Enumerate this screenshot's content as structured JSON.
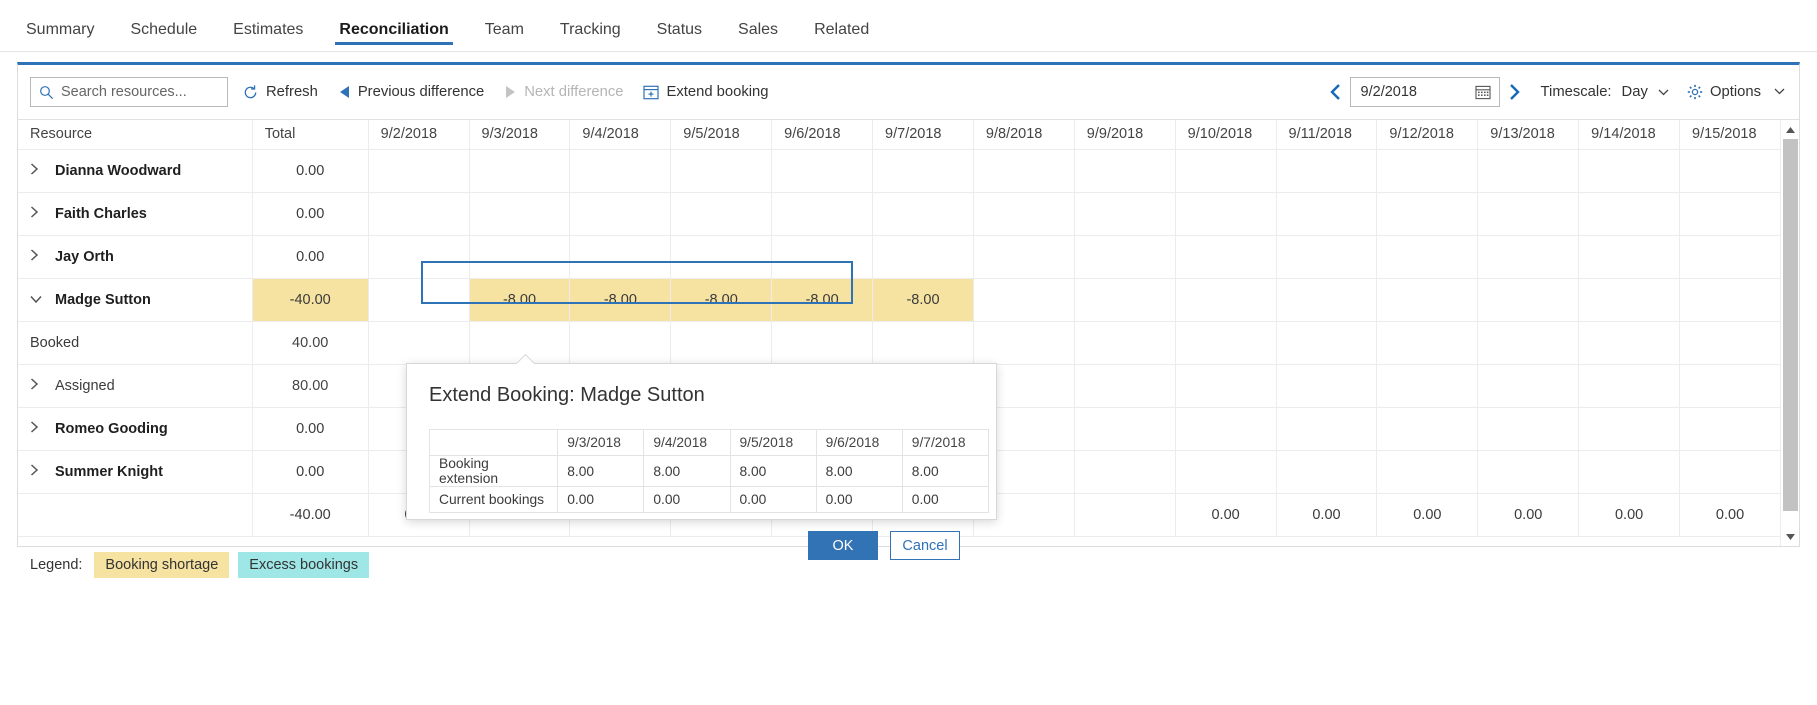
{
  "tabs": [
    {
      "label": "Summary",
      "active": false
    },
    {
      "label": "Schedule",
      "active": false
    },
    {
      "label": "Estimates",
      "active": false
    },
    {
      "label": "Reconciliation",
      "active": true
    },
    {
      "label": "Team",
      "active": false
    },
    {
      "label": "Tracking",
      "active": false
    },
    {
      "label": "Status",
      "active": false
    },
    {
      "label": "Sales",
      "active": false
    },
    {
      "label": "Related",
      "active": false
    }
  ],
  "toolbar": {
    "search_placeholder": "Search resources...",
    "search_value": "",
    "refresh_label": "Refresh",
    "previous_difference_label": "Previous difference",
    "next_difference_label": "Next difference",
    "extend_booking_label": "Extend booking",
    "prev_arrow": "‹",
    "next_arrow": "›",
    "date_value": "9/2/2018",
    "timescale_label": "Timescale:",
    "timescale_value": "Day",
    "options_label": "Options",
    "caret": "⌄"
  },
  "grid": {
    "columns": [
      "Resource",
      "Total",
      "9/2/2018",
      "9/3/2018",
      "9/4/2018",
      "9/5/2018",
      "9/6/2018",
      "9/7/2018",
      "9/8/2018",
      "9/9/2018",
      "9/10/2018",
      "9/11/2018",
      "9/12/2018",
      "9/13/2018",
      "9/14/2018",
      "9/15/2018"
    ],
    "rows": [
      {
        "name": "Dianna Woodward",
        "level": 0,
        "expanded": false,
        "has_chevron": true,
        "bold": true,
        "total": "0.00",
        "total_highlight": "",
        "cells": [
          "",
          "",
          "",
          "",
          "",
          "",
          "",
          "",
          "",
          "",
          "",
          "",
          "",
          ""
        ]
      },
      {
        "name": "Faith Charles",
        "level": 0,
        "expanded": false,
        "has_chevron": true,
        "bold": true,
        "total": "0.00",
        "total_highlight": "",
        "cells": [
          "",
          "",
          "",
          "",
          "",
          "",
          "",
          "",
          "",
          "",
          "",
          "",
          "",
          ""
        ]
      },
      {
        "name": "Jay Orth",
        "level": 0,
        "expanded": false,
        "has_chevron": true,
        "bold": true,
        "total": "0.00",
        "total_highlight": "",
        "cells": [
          "",
          "",
          "",
          "",
          "",
          "",
          "",
          "",
          "",
          "",
          "",
          "",
          "",
          ""
        ]
      },
      {
        "name": "Madge Sutton",
        "level": 0,
        "expanded": true,
        "has_chevron": true,
        "bold": true,
        "total": "-40.00",
        "total_highlight": "shortage",
        "cells": [
          "",
          "-8.00",
          "-8.00",
          "-8.00",
          "-8.00",
          "-8.00",
          "",
          "",
          "",
          "",
          "",
          "",
          "",
          ""
        ],
        "cell_highlight": [
          "",
          "shortage",
          "shortage",
          "shortage",
          "shortage",
          "shortage",
          "",
          "",
          "",
          "",
          "",
          "",
          "",
          ""
        ]
      },
      {
        "name": "Booked",
        "level": 1,
        "expanded": false,
        "has_chevron": false,
        "bold": false,
        "total": "40.00",
        "total_highlight": "",
        "cells": [
          "",
          "",
          "",
          "",
          "",
          "",
          "",
          "",
          "",
          "",
          "",
          "",
          "",
          ""
        ]
      },
      {
        "name": "Assigned",
        "level": 1,
        "expanded": false,
        "has_chevron": true,
        "bold": false,
        "total": "80.00",
        "total_highlight": "",
        "cells": [
          "",
          "",
          "",
          "",
          "",
          "",
          "",
          "",
          "",
          "",
          "",
          "",
          "",
          ""
        ]
      },
      {
        "name": "Romeo Gooding",
        "level": 0,
        "expanded": false,
        "has_chevron": true,
        "bold": true,
        "total": "0.00",
        "total_highlight": "",
        "cells": [
          "",
          "",
          "",
          "",
          "",
          "",
          "",
          "",
          "",
          "",
          "",
          "",
          "",
          ""
        ]
      },
      {
        "name": "Summer Knight",
        "level": 0,
        "expanded": false,
        "has_chevron": true,
        "bold": true,
        "total": "0.00",
        "total_highlight": "",
        "cells": [
          "",
          "",
          "",
          "",
          "",
          "",
          "",
          "",
          "",
          "",
          "",
          "",
          "",
          ""
        ]
      }
    ],
    "footer": {
      "name": "",
      "total": "-40.00",
      "cells": [
        "0.00",
        "",
        "",
        "",
        "",
        "",
        "",
        "",
        "0.00",
        "0.00",
        "0.00",
        "0.00",
        "0.00",
        "0.00"
      ]
    }
  },
  "legend": {
    "label": "Legend:",
    "items": [
      {
        "text": "Booking shortage",
        "color": "#f7e3a1"
      },
      {
        "text": "Excess bookings",
        "color": "#9fe7e7"
      }
    ]
  },
  "dialog": {
    "title": "Extend Booking: Madge Sutton",
    "columns": [
      "",
      "9/3/2018",
      "9/4/2018",
      "9/5/2018",
      "9/6/2018",
      "9/7/2018"
    ],
    "rows": [
      {
        "label": "Booking extension",
        "values": [
          "8.00",
          "8.00",
          "8.00",
          "8.00",
          "8.00"
        ]
      },
      {
        "label": "Current bookings",
        "values": [
          "0.00",
          "0.00",
          "0.00",
          "0.00",
          "0.00"
        ]
      }
    ],
    "ok_label": "OK",
    "cancel_label": "Cancel"
  },
  "colors": {
    "accent": "#2e72b8",
    "shortage": "#f7e3a1",
    "excess": "#9fe7e7",
    "primary_button": "#3273b5"
  }
}
